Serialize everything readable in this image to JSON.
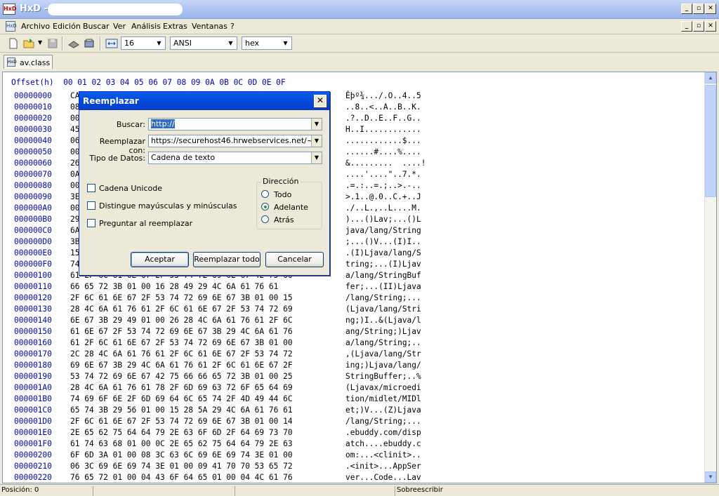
{
  "window": {
    "title": "HxD - ["
  },
  "menu": [
    "Archivo",
    "Edición",
    "Buscar",
    "Ver",
    "Análisis",
    "Extras",
    "Ventanas",
    "?"
  ],
  "toolbar": {
    "bytes_per_row": "16",
    "charset": "ANSI",
    "display": "hex"
  },
  "tab": {
    "label": "av.class"
  },
  "editor": {
    "header": "Offset(h)  00 01 02 03 04 05 06 07 08 09 0A 0B 0C 0D 0E 0F",
    "rows": [
      {
        "off": "00000000",
        "hex": "CA",
        "text": "Êþº¾.../.O..4..5"
      },
      {
        "off": "00000010",
        "hex": "08",
        "text": "..8..<..A..B..K."
      },
      {
        "off": "00000020",
        "hex": "00",
        "text": ".?..D..E..F..G.."
      },
      {
        "off": "00000030",
        "hex": "45",
        "text": "H..I............"
      },
      {
        "off": "00000040",
        "hex": "06",
        "text": "............$..."
      },
      {
        "off": "00000050",
        "hex": "00",
        "text": "......#....%...."
      },
      {
        "off": "00000060",
        "hex": "26",
        "text": "&.........  ....!"
      },
      {
        "off": "00000070",
        "hex": "0A",
        "text": "....'....\"..7.*."
      },
      {
        "off": "00000080",
        "hex": "00",
        "text": ".=.:..=.;..>.-.."
      },
      {
        "off": "00000090",
        "hex": "3E",
        "text": ">.1..@.0..C.+..J"
      },
      {
        "off": "000000A0",
        "hex": "00",
        "text": "./..L.,..L....M."
      },
      {
        "off": "000000B0",
        "hex": "29",
        "text": ")...()Lav;...()L"
      },
      {
        "off": "000000C0",
        "hex": "6A",
        "text": "java/lang/String"
      },
      {
        "off": "000000D0",
        "hex": "3B",
        "text": ";...()V...(I)I.."
      },
      {
        "off": "000000E0",
        "hex": "15",
        "text": ".(I)Ljava/lang/S"
      },
      {
        "off": "000000F0",
        "hex": "74",
        "text": "tring;...(I)Ljav"
      },
      {
        "off": "00000100",
        "hex": "61 2F 6C 61 6E 67 2F 53 74 72 69 6E 67 42 75 66",
        "text": "a/lang/StringBuf"
      },
      {
        "off": "00000110",
        "hex": "66 65 72 3B 01 00 16 28 49 29 4C 6A 61 76 61",
        "text": "fer;...(II)Ljava"
      },
      {
        "off": "00000120",
        "hex": "2F 6C 61 6E 67 2F 53 74 72 69 6E 67 3B 01 00 15",
        "text": "/lang/String;..."
      },
      {
        "off": "00000130",
        "hex": "28 4C 6A 61 76 61 2F 6C 61 6E 67 2F 53 74 72 69",
        "text": "(Ljava/lang/Stri"
      },
      {
        "off": "00000140",
        "hex": "6E 67 3B 29 49 01 00 26 28 4C 6A 61 76 61 2F 6C",
        "text": "ng;)I..&(Ljava/l"
      },
      {
        "off": "00000150",
        "hex": "61 6E 67 2F 53 74 72 69 6E 67 3B 29 4C 6A 61 76",
        "text": "ang/String;)Ljav"
      },
      {
        "off": "00000160",
        "hex": "61 2F 6C 61 6E 67 2F 53 74 72 69 6E 67 3B 01 00",
        "text": "a/lang/String;.."
      },
      {
        "off": "00000170",
        "hex": "2C 28 4C 6A 61 76 61 2F 6C 61 6E 67 2F 53 74 72",
        "text": ",(Ljava/lang/Str"
      },
      {
        "off": "00000180",
        "hex": "69 6E 67 3B 29 4C 6A 61 76 61 2F 6C 61 6E 67 2F",
        "text": "ing;)Ljava/lang/"
      },
      {
        "off": "00000190",
        "hex": "53 74 72 69 6E 67 42 75 66 66 65 72 3B 01 00 25",
        "text": "StringBuffer;..%"
      },
      {
        "off": "000001A0",
        "hex": "28 4C 6A 61 76 61 78 2F 6D 69 63 72 6F 65 64 69",
        "text": "(Ljavax/microedi"
      },
      {
        "off": "000001B0",
        "hex": "74 69 6F 6E 2F 6D 69 64 6C 65 74 2F 4D 49 44 6C",
        "text": "tion/midlet/MIDl"
      },
      {
        "off": "000001C0",
        "hex": "65 74 3B 29 56 01 00 15 28 5A 29 4C 6A 61 76 61",
        "text": "et;)V...(Z)Ljava"
      },
      {
        "off": "000001D0",
        "hex": "2F 6C 61 6E 67 2F 53 74 72 69 6E 67 3B 01 00 14",
        "text": "/lang/String;..."
      },
      {
        "off": "000001E0",
        "hex": "2E 65 62 75 64 64 79 2E 63 6F 6D 2F 64 69 73 70",
        "text": ".ebuddy.com/disp"
      },
      {
        "off": "000001F0",
        "hex": "61 74 63 68 01 00 0C 2E 65 62 75 64 64 79 2E 63",
        "text": "atch....ebuddy.c"
      },
      {
        "off": "00000200",
        "hex": "6F 6D 3A 01 00 08 3C 63 6C 69 6E 69 74 3E 01 00",
        "text": "om:...<clinit>.."
      },
      {
        "off": "00000210",
        "hex": "06 3C 69 6E 69 74 3E 01 00 09 41 70 70 53 65 72",
        "text": ".<init>...AppSer"
      },
      {
        "off": "00000220",
        "hex": "76 65 72 01 00 04 43 6F 64 65 01 00 04 4C 61 76",
        "text": "ver...Code...Lav"
      }
    ]
  },
  "dialog": {
    "title": "Reemplazar",
    "search_label": "Buscar:",
    "search_value": "http://",
    "replace_label": "Reemplazar con:",
    "replace_value": "https://securehost46.hrwebservices.net/~dtag",
    "datatype_label": "Tipo de Datos:",
    "datatype_value": "Cadena de texto",
    "unicode_label": "Cadena Unicode",
    "case_label": "Distingue mayúsculas y minúsculas",
    "prompt_label": "Preguntar al reemplazar",
    "direction_title": "Dirección",
    "dir_all": "Todo",
    "dir_forward": "Adelante",
    "dir_back": "Atrás",
    "ok_label": "Aceptar",
    "replace_all_label": "Reemplazar todo",
    "cancel_label": "Cancelar"
  },
  "status": {
    "position": "Posición: 0",
    "mode": "Sobreescribir"
  }
}
